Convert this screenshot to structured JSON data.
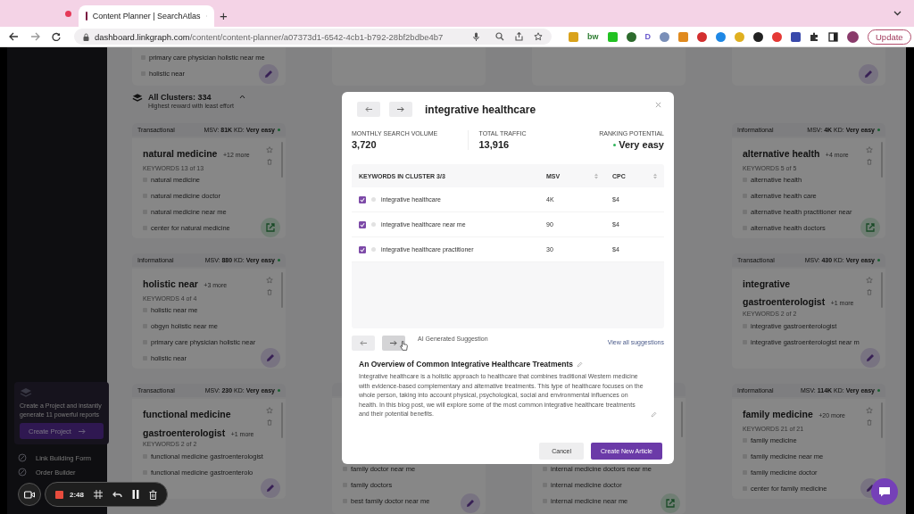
{
  "browser": {
    "tab_title": "Content Planner | SearchAtlas",
    "new_tab": "+",
    "url_host": "dashboard.linkgraph.com",
    "url_path": "/content/content-planner/a07373d1-6542-4cb1-b792-28bf2bdbe4b7",
    "update_button": "Update",
    "extensions": [
      {
        "kind": "square",
        "color": "#d9a21b"
      },
      {
        "kind": "glyph",
        "text": "bw",
        "color": "#2e7d32"
      },
      {
        "kind": "square",
        "color": "#22c222"
      },
      {
        "kind": "circle",
        "color": "#2d6b2d"
      },
      {
        "kind": "glyph",
        "text": "D",
        "color": "#6a5acd"
      },
      {
        "kind": "circle",
        "color": "#7a8fb8"
      },
      {
        "kind": "square",
        "color": "#e08a1e"
      },
      {
        "kind": "circle",
        "color": "#d32f2f"
      },
      {
        "kind": "circle",
        "color": "#1e88e5"
      },
      {
        "kind": "circle",
        "color": "#e0b020"
      },
      {
        "kind": "circle",
        "color": "#222222"
      },
      {
        "kind": "circle",
        "color": "#e53935"
      },
      {
        "kind": "square",
        "color": "#3949ab"
      }
    ]
  },
  "sidebar": {
    "promo_text": "Create a Project and instantly generate 11 powerful reports",
    "promo_button": "Create Project",
    "links": [
      "Link Building Form",
      "Order Builder"
    ]
  },
  "clusters_header": {
    "title": "All Clusters: 334",
    "subtitle": "Highest reward with least effort"
  },
  "columns": [
    {
      "tail": {
        "keywords": [
          "primary care physician holistic near me",
          "holistic near"
        ],
        "action": {
          "kind": "edit"
        }
      },
      "cards": [
        {
          "intent": "Transactional",
          "metrics": "MSV: **81K** KD: **Very easy**",
          "title": "natural medicine",
          "more": "+12 more",
          "count": "KEYWORDS 13 of 13",
          "keywords": [
            "natural medicine",
            "natural medicine doctor",
            "natural medicine near me",
            "center for natural medicine"
          ],
          "action": {
            "kind": "open"
          }
        },
        {
          "intent": "Informational",
          "metrics": "MSV: **880** KD: **Very easy**",
          "title": "holistic near",
          "more": "+3 more",
          "count": "KEYWORDS 4 of 4",
          "keywords": [
            "holistic near me",
            "obgyn holistic near me",
            "primary care physician holistic near",
            "holistic near"
          ],
          "action": {
            "kind": "edit"
          }
        },
        {
          "intent": "Transactional",
          "metrics": "MSV: **230** KD: **Very easy**",
          "title": "functional medicine gastroenterologist",
          "more": "+1 more",
          "count": "KEYWORDS 2 of 2",
          "keywords": [
            "functional medicine gastroenterologist",
            "functional medicine gastroenterolo"
          ],
          "action": {
            "kind": "edit"
          }
        }
      ]
    },
    {
      "cards": [
        {
          "keywords": [
            "family doctor near me",
            "family doctors",
            "best family doctor near me"
          ],
          "action": {
            "kind": "edit"
          }
        }
      ]
    },
    {
      "cards": [
        {
          "keywords": [
            "internal medicine doctors near me",
            "internal medicine doctor",
            "internal medicine near me"
          ],
          "action": {
            "kind": "open"
          }
        }
      ]
    },
    {
      "tail": {
        "action": {
          "kind": "edit"
        }
      },
      "cards": [
        {
          "intent": "Informational",
          "metrics": "MSV: **4K** KD: **Very easy**",
          "title": "alternative health",
          "more": "+4 more",
          "count": "KEYWORDS 5 of 5",
          "keywords": [
            "alternative health",
            "alternative health care",
            "alternative health practitioner near",
            "alternative health doctors"
          ],
          "action": {
            "kind": "open"
          }
        },
        {
          "intent": "Transactional",
          "metrics": "MSV: **430** KD: **Very easy**",
          "title": "integrative gastroenterologist",
          "more": "+1 more",
          "count": "KEYWORDS 2 of 2",
          "keywords": [
            "integrative gastroenterologist",
            "integrative gastroenterologist near m"
          ],
          "action": {
            "kind": "edit"
          }
        },
        {
          "intent": "Informational",
          "metrics": "MSV: **114K** KD: **Very easy**",
          "title": "family medicine",
          "more": "+20 more",
          "count": "KEYWORDS 21 of 21",
          "keywords": [
            "family medicine",
            "family medicine near me",
            "family medicine doctor",
            "center for family medicine"
          ],
          "action": {
            "kind": "edit"
          }
        }
      ]
    }
  ],
  "modal": {
    "title": "integrative healthcare",
    "stats": [
      {
        "label": "MONTHLY SEARCH VOLUME",
        "value": "3,720"
      },
      {
        "label": "TOTAL TRAFFIC",
        "value": "13,916"
      },
      {
        "label": "RANKING POTENTIAL",
        "value": "Very easy",
        "dot": true
      }
    ],
    "table": {
      "columns": [
        "KEYWORDS IN CLUSTER 3/3",
        "MSV",
        "CPC"
      ],
      "rows": [
        {
          "checked": true,
          "keyword": "integrative healthcare",
          "msv": "4K",
          "cpc": "$4"
        },
        {
          "checked": true,
          "keyword": "integrative healthcare near me",
          "msv": "90",
          "cpc": "$4"
        },
        {
          "checked": true,
          "keyword": "integrative healthcare practitioner",
          "msv": "30",
          "cpc": "$4"
        }
      ]
    },
    "suggestion_label": "AI Generated Suggestion",
    "view_all": "View all suggestions",
    "suggestion_title": "An Overview of Common Integrative Healthcare Treatments",
    "suggestion_text": "Integrative healthcare is a holistic approach to healthcare that combines traditional Western medicine with evidence-based complementary and alternative treatments. This type of healthcare focuses on the whole person, taking into account physical, psychological, social and environmental influences on health. In this blog post, we will explore some of the most common integrative healthcare treatments and their potential benefits.",
    "cancel": "Cancel",
    "create": "Create New Article"
  },
  "recorder": {
    "time": "2:48"
  }
}
